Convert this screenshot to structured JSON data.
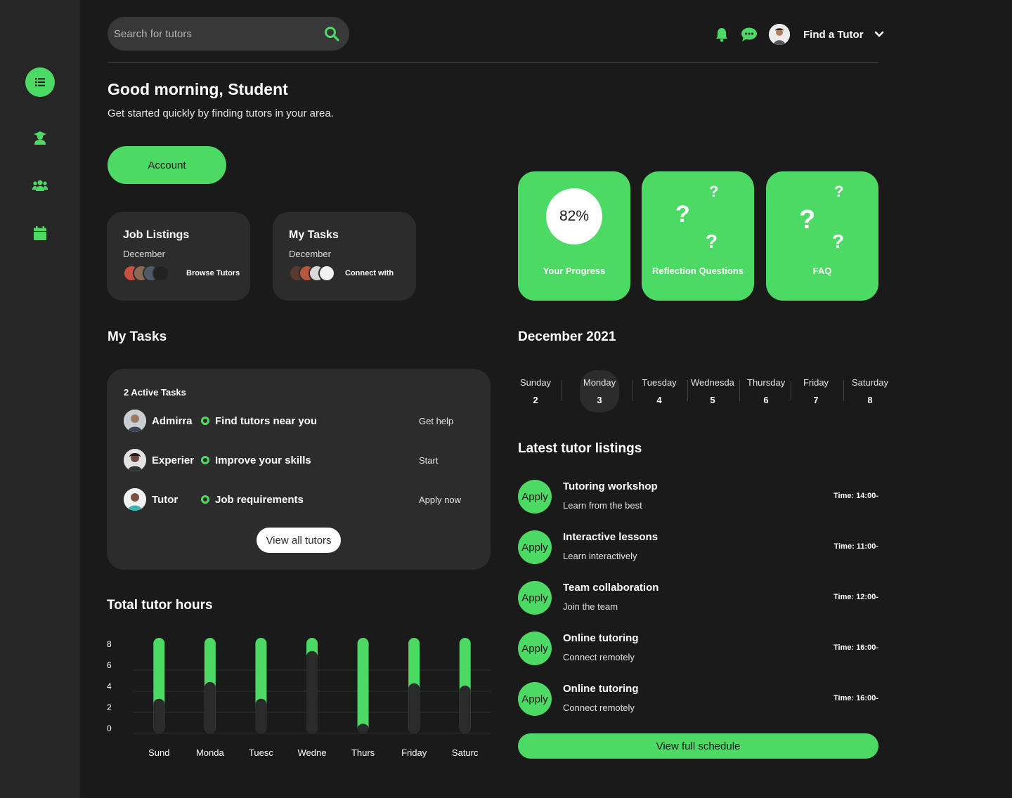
{
  "colors": {
    "accent": "#4cd964",
    "background": "#1a1a1a",
    "panel": "#2c2c2c",
    "sidebar": "#262626"
  },
  "sidebar": {
    "items": [
      {
        "icon": "list-icon",
        "active": true
      },
      {
        "icon": "graduate-icon",
        "active": false
      },
      {
        "icon": "users-icon",
        "active": false
      },
      {
        "icon": "calendar-icon",
        "active": false
      }
    ]
  },
  "search": {
    "placeholder": "Search for tutors",
    "value": ""
  },
  "header": {
    "user_menu_label": "Find a Tutor"
  },
  "greeting": {
    "title": "Good morning, Student",
    "subtitle": "Get started quickly by finding tutors in your area."
  },
  "account_button": "Account",
  "cards": [
    {
      "title": "Job Listings",
      "subtitle": "December",
      "action": "Browse Tutors"
    },
    {
      "title": "My Tasks",
      "subtitle": "December",
      "action": "Connect with"
    }
  ],
  "tiles": {
    "progress": {
      "value": "82%",
      "fraction": 0.82,
      "label": "Your Progress"
    },
    "reflection": {
      "label": "Reflection Questions",
      "mark": "?"
    },
    "faq": {
      "label": "FAQ",
      "mark": "?"
    }
  },
  "tasks": {
    "heading": "My Tasks",
    "count_label": "2 Active Tasks",
    "rows": [
      {
        "name": "Admirra",
        "title": "Find tutors near you",
        "action": "Get help"
      },
      {
        "name": "Experienced",
        "title": "Improve your skills",
        "action": "Start"
      },
      {
        "name": "Tutor",
        "title": "Job requirements",
        "action": "Apply now"
      }
    ],
    "view_all": "View all tutors"
  },
  "chart_data": {
    "type": "bar",
    "title": "Total tutor hours",
    "categories": [
      "Sunday",
      "Monday",
      "Tuesday",
      "Wednesday",
      "Thursday",
      "Friday",
      "Saturday"
    ],
    "tick_labels": [
      "Sund",
      "Monda",
      "Tuesc",
      "Wedne",
      "Thurs",
      "Friday",
      "Saturc"
    ],
    "series": [
      {
        "values": [
          2.9,
          4.3,
          2.9,
          6.9,
          0.8,
          4.2,
          4.0
        ]
      }
    ],
    "ylim": [
      0,
      8
    ],
    "yticks": [
      0,
      2,
      4,
      6,
      8
    ],
    "grid": true
  },
  "calendar": {
    "title": "December 2021",
    "days": [
      {
        "name": "Sunday",
        "date": "2"
      },
      {
        "name": "Monday",
        "date": "3"
      },
      {
        "name": "Tuesday",
        "date": "4"
      },
      {
        "name": "Wednesday",
        "date": "5"
      },
      {
        "name": "Thursday",
        "date": "6"
      },
      {
        "name": "Friday",
        "date": "7"
      },
      {
        "name": "Saturday",
        "date": "8"
      }
    ],
    "selected": "Monday"
  },
  "listings": {
    "heading": "Latest tutor listings",
    "apply_label": "Apply",
    "items": [
      {
        "title": "Tutoring workshop",
        "subtitle": "Learn from the best",
        "time": "Time: 14:00-"
      },
      {
        "title": "Interactive lessons",
        "subtitle": "Learn interactively",
        "time": "Time: 11:00-"
      },
      {
        "title": "Team collaboration",
        "subtitle": "Join the team",
        "time": "Time: 12:00-"
      },
      {
        "title": "Online tutoring",
        "subtitle": "Connect remotely",
        "time": "Time: 16:00-"
      },
      {
        "title": "Online tutoring",
        "subtitle": "Connect remotely",
        "time": "Time: 16:00-"
      }
    ],
    "full_schedule": "View full schedule"
  }
}
